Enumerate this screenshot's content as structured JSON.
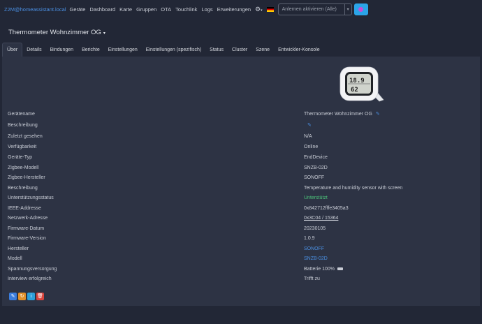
{
  "nav": {
    "brand": "Z2M@homeassistant.local",
    "links": [
      "Geräte",
      "Dashboard",
      "Karte",
      "Gruppen",
      "OTA",
      "Touchlink",
      "Logs",
      "Erweiterungen"
    ],
    "permit_join_label": "Anlernen aktivieren (Alle)"
  },
  "device": {
    "title": "Thermometer Wohnzimmer OG"
  },
  "tabs": [
    "Über",
    "Details",
    "Bindungen",
    "Berichte",
    "Einstellungen",
    "Einstellungen (spezifisch)",
    "Status",
    "Cluster",
    "Szene",
    "Entwickler-Konsole"
  ],
  "image_display": {
    "temperature": "18.9",
    "humidity": "62"
  },
  "fields": [
    {
      "label": "Gerätename",
      "value": "Thermometer Wohnzimmer OG"
    },
    {
      "label": "Beschreibung",
      "value": ""
    },
    {
      "label": "Zuletzt gesehen",
      "value": "N/A"
    },
    {
      "label": "Verfügbarkeit",
      "value": "Online"
    },
    {
      "label": "Geräte-Typ",
      "value": "EndDevice"
    },
    {
      "label": "Zigbee-Modell",
      "value": "SNZB-02D"
    },
    {
      "label": "Zigbee-Hersteller",
      "value": "SONOFF"
    },
    {
      "label": "Beschreibung",
      "value": "Temperature and humidity sensor with screen"
    },
    {
      "label": "Unterstützungsstatus",
      "value": "Unterstützt"
    },
    {
      "label": "IEEE-Addresse",
      "value": "0x842712fffe3405a3"
    },
    {
      "label": "Netzwerk-Adresse",
      "value": "0x3C04 / 15364"
    },
    {
      "label": "Firmware-Datum",
      "value": "20230105"
    },
    {
      "label": "Firmware-Version",
      "value": "1.0.9"
    },
    {
      "label": "Hersteller",
      "value": "SONOFF"
    },
    {
      "label": "Modell",
      "value": "SNZB-02D"
    },
    {
      "label": "Spannungsversorgung",
      "value": "Batterie 100%"
    },
    {
      "label": "Interview erfolgreich",
      "value": "Trifft zu"
    }
  ],
  "colors": {
    "accent": "#4a8fe2",
    "success": "#4cc47a",
    "background": "#222736",
    "panel": "#2d3344"
  }
}
